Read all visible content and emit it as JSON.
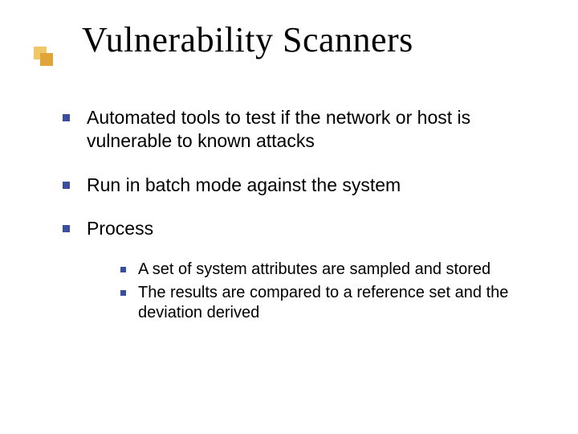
{
  "slide": {
    "title": "Vulnerability Scanners",
    "bullets": [
      {
        "text": "Automated tools to test if the network or host is vulnerable to known attacks"
      },
      {
        "text": "Run in batch mode against the system"
      },
      {
        "text": "Process",
        "sub": [
          "A set of system attributes are sampled and stored",
          "The results are compared to a reference set and the deviation derived"
        ]
      }
    ]
  }
}
